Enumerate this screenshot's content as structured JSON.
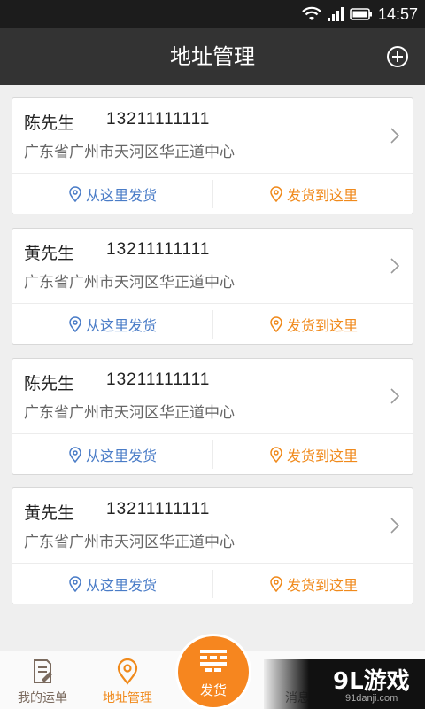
{
  "status_bar": {
    "time": "14:57"
  },
  "header": {
    "title": "地址管理"
  },
  "addresses": [
    {
      "name": "陈先生",
      "phone": "13211111111",
      "address": "广东省广州市天河区华正道中心",
      "ship_from_label": "从这里发货",
      "ship_to_label": "发货到这里"
    },
    {
      "name": "黄先生",
      "phone": "13211111111",
      "address": "广东省广州市天河区华正道中心",
      "ship_from_label": "从这里发货",
      "ship_to_label": "发货到这里"
    },
    {
      "name": "陈先生",
      "phone": "13211111111",
      "address": "广东省广州市天河区华正道中心",
      "ship_from_label": "从这里发货",
      "ship_to_label": "发货到这里"
    },
    {
      "name": "黄先生",
      "phone": "13211111111",
      "address": "广东省广州市天河区华正道中心",
      "ship_from_label": "从这里发货",
      "ship_to_label": "发货到这里"
    }
  ],
  "bottom_nav": {
    "waybill_label": "我的运单",
    "address_label": "地址管理",
    "ship_label": "发货",
    "message_label": "消息"
  },
  "watermark": {
    "logo": "9L游戏",
    "site": "91danji.com"
  },
  "colors": {
    "accent": "#f08a1c",
    "link_blue": "#4a7cc7",
    "app_bar": "#333333"
  }
}
